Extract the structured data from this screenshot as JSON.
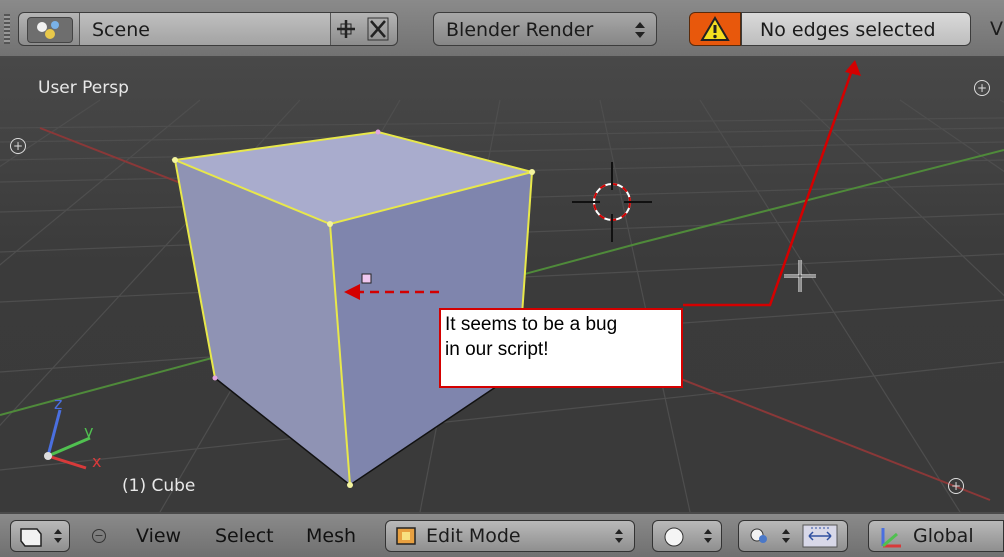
{
  "header": {
    "scene_label": "Scene",
    "render_engine": "Blender Render",
    "status_message": "No edges selected",
    "overflow_text": "V"
  },
  "viewport": {
    "view_label": "User Persp",
    "object_label": "(1) Cube",
    "axis_labels": {
      "x": "x",
      "y": "y",
      "z": "z"
    }
  },
  "annotation": {
    "line1": "It seems to be a bug",
    "line2": "in our script!"
  },
  "footer": {
    "menu_view": "View",
    "menu_select": "Select",
    "menu_mesh": "Mesh",
    "mode": "Edit Mode",
    "orientation": "Global"
  },
  "colors": {
    "warning": "#e8580c",
    "accent_red": "#d40000",
    "edge_yellow": "#e8e84a"
  }
}
